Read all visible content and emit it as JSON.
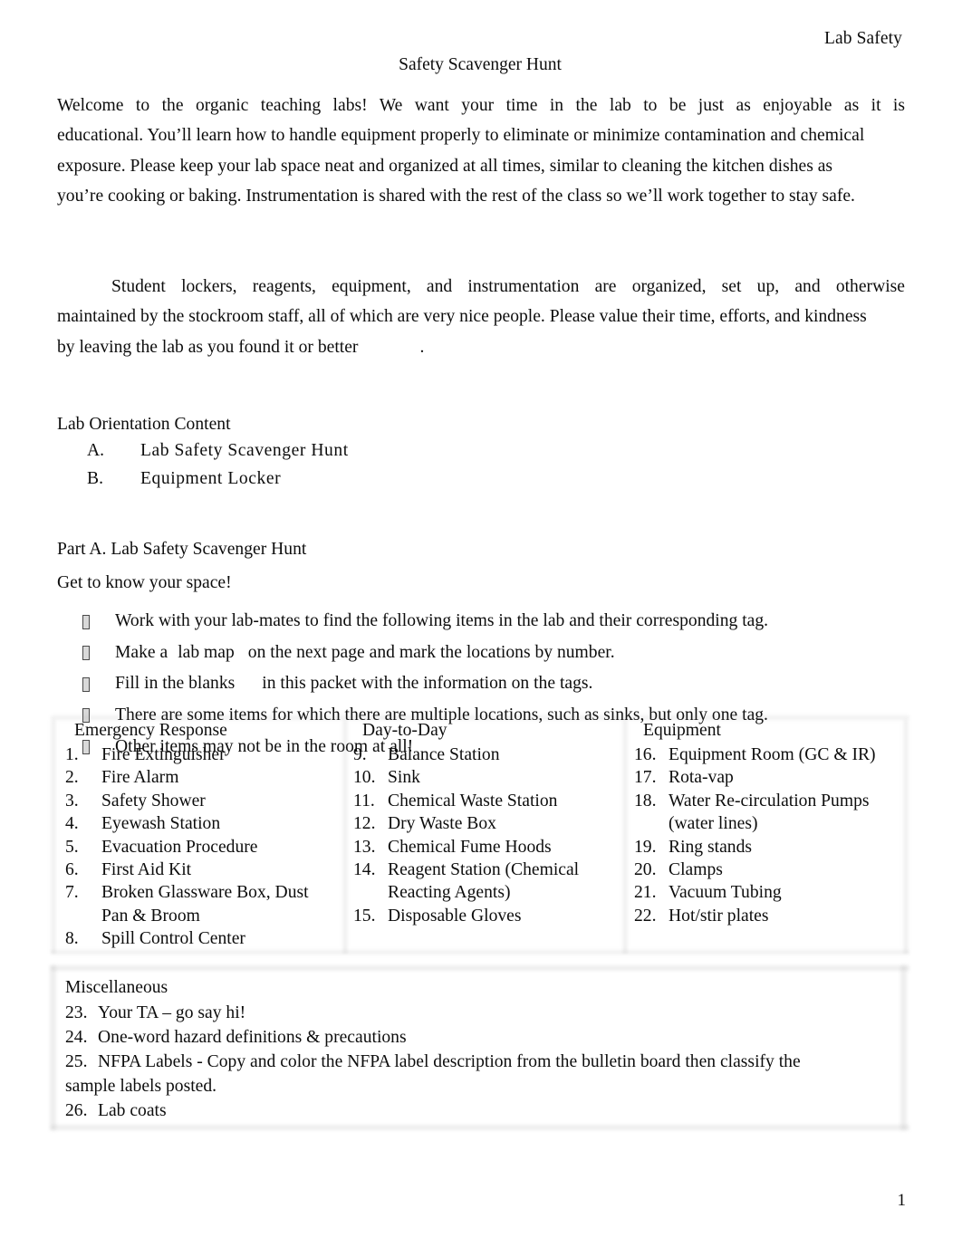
{
  "document": {
    "running_head": "Lab Safety",
    "title": "Safety Scavenger Hunt",
    "page_number": "1"
  },
  "intro": {
    "paragraph_1": {
      "line_1": "Welcome to the organic teaching labs!        We want your time in the lab to be just as enjoyable as it is",
      "line_2": "educational. You’ll learn how to handle equipment properly to eliminate or minimize contamination and chemical",
      "line_3": "exposure. Please keep your lab space neat and organized at all times, similar to cleaning the kitchen dishes as",
      "line_4": "you’re cooking or baking. Instrumentation is shared with the rest of the class so we’ll work together to stay safe."
    },
    "paragraph_2": {
      "line_1": "Student lockers, reagents, equipment, and instrumentation are organized, set up, and otherwise",
      "line_2": "maintained by the stockroom staff, all of which are very nice people. Please value their time, efforts, and kindness",
      "line_3_before": "by leaving the lab as you found it or better",
      "line_3_after": "."
    }
  },
  "orientation": {
    "heading": "Lab Orientation Content",
    "items": [
      {
        "marker": "A.",
        "label": "Lab Safety Scavenger Hunt"
      },
      {
        "marker": "B.",
        "label": "Equipment Locker"
      }
    ]
  },
  "part_a": {
    "heading": "Part A. Lab Safety Scavenger Hunt",
    "subheading": "Get to know your space!",
    "bullets": [
      {
        "text": "Work with your lab-mates to find the following items in the lab and their corresponding tag."
      },
      {
        "text_before": "Make a",
        "emphasis": "lab map",
        "text_after": "on the next page and mark the locations by number."
      },
      {
        "text_before": "Fill in the blanks",
        "emphasis": "",
        "text_after": "in this packet with the information on the tags."
      },
      {
        "text": "There are some items for which there are multiple locations, such as sinks, but only one tag."
      },
      {
        "text": "Other items may not be in the room at all!"
      }
    ]
  },
  "item_table": {
    "columns": [
      {
        "heading": "Emergency Response",
        "items": [
          {
            "num": "1.",
            "label": "Fire Extinguisher"
          },
          {
            "num": "2.",
            "label": "Fire Alarm"
          },
          {
            "num": "3.",
            "label": "Safety Shower"
          },
          {
            "num": "4.",
            "label": "Eyewash Station"
          },
          {
            "num": "5.",
            "label": "Evacuation Procedure"
          },
          {
            "num": "6.",
            "label": "First Aid Kit"
          },
          {
            "num": "7.",
            "label": "Broken Glassware Box, Dust",
            "continuation": "Pan & Broom"
          },
          {
            "num": "8.",
            "label": "Spill Control Center"
          }
        ]
      },
      {
        "heading": "Day-to-Day",
        "items": [
          {
            "num": "9.",
            "label": "Balance Station"
          },
          {
            "num": "10.",
            "label": "Sink"
          },
          {
            "num": "11.",
            "label": "Chemical Waste Station"
          },
          {
            "num": "12.",
            "label": "Dry Waste Box"
          },
          {
            "num": "13.",
            "label": "Chemical Fume Hoods"
          },
          {
            "num": "14.",
            "label": "Reagent Station (Chemical",
            "continuation": "Reacting Agents)"
          },
          {
            "num": "15.",
            "label": "Disposable Gloves"
          }
        ]
      },
      {
        "heading": "Equipment",
        "items": [
          {
            "num": "16.",
            "label": "Equipment Room (GC & IR)"
          },
          {
            "num": "17.",
            "label": "Rota-vap"
          },
          {
            "num": "18.",
            "label": "Water Re-circulation Pumps",
            "continuation": "(water lines)"
          },
          {
            "num": "19.",
            "label": "Ring stands"
          },
          {
            "num": "20.",
            "label": "Clamps"
          },
          {
            "num": "21.",
            "label": "Vacuum Tubing"
          },
          {
            "num": "22.",
            "label": "Hot/stir plates"
          }
        ]
      }
    ]
  },
  "misc": {
    "heading": "Miscellaneous",
    "items": [
      {
        "num": "23.",
        "label": "Your TA – go say hi!"
      },
      {
        "num": "24.",
        "label": "One-word hazard definitions & precautions"
      },
      {
        "num": "25.",
        "label": "NFPA Labels - Copy and color the NFPA label description from the bulletin board then classify the",
        "continuation": "sample labels posted."
      },
      {
        "num": "26.",
        "label": "Lab coats"
      }
    ]
  }
}
